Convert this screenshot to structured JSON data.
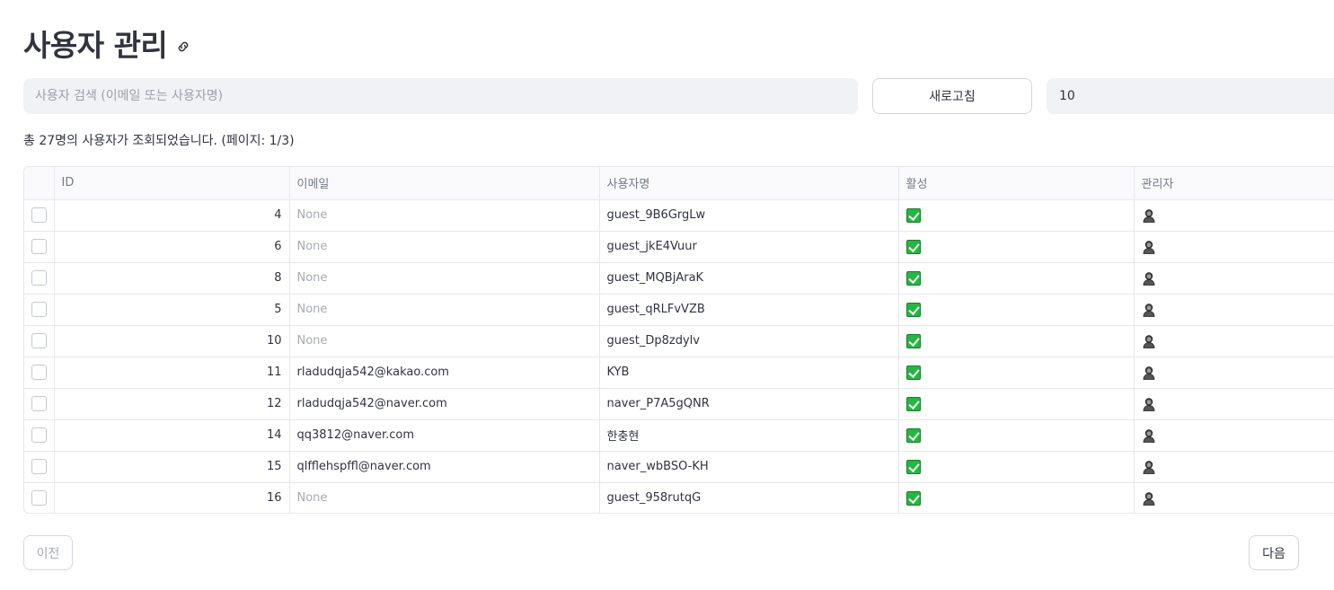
{
  "header": {
    "title": "사용자 관리",
    "link_icon": "link-icon"
  },
  "search": {
    "placeholder": "사용자 검색 (이메일 또는 사용자명)",
    "value": ""
  },
  "toolbar": {
    "refresh_label": "새로고침",
    "page_size": "10"
  },
  "summary": "총 27명의 사용자가 조회되었습니다. (페이지: 1/3)",
  "table": {
    "columns": [
      "ID",
      "이메일",
      "사용자명",
      "활성",
      "관리자"
    ],
    "rows": [
      {
        "id": "4",
        "email": "None",
        "username": "guest_9B6GrgLw",
        "active": true,
        "admin_icon": "person-icon"
      },
      {
        "id": "6",
        "email": "None",
        "username": "guest_jkE4Vuur",
        "active": true,
        "admin_icon": "person-icon"
      },
      {
        "id": "8",
        "email": "None",
        "username": "guest_MQBjAraK",
        "active": true,
        "admin_icon": "person-icon"
      },
      {
        "id": "5",
        "email": "None",
        "username": "guest_qRLFvVZB",
        "active": true,
        "admin_icon": "person-icon"
      },
      {
        "id": "10",
        "email": "None",
        "username": "guest_Dp8zdylv",
        "active": true,
        "admin_icon": "person-icon"
      },
      {
        "id": "11",
        "email": "rladudqja542@kakao.com",
        "username": "KYB",
        "active": true,
        "admin_icon": "person-icon"
      },
      {
        "id": "12",
        "email": "rladudqja542@naver.com",
        "username": "naver_P7A5gQNR",
        "active": true,
        "admin_icon": "person-icon"
      },
      {
        "id": "14",
        "email": "qq3812@naver.com",
        "username": "한충현",
        "active": true,
        "admin_icon": "person-icon"
      },
      {
        "id": "15",
        "email": "qlfflehspffl@naver.com",
        "username": "naver_wbBSO-KH",
        "active": true,
        "admin_icon": "person-icon"
      },
      {
        "id": "16",
        "email": "None",
        "username": "guest_958rutqG",
        "active": true,
        "admin_icon": "person-icon"
      }
    ]
  },
  "pagination": {
    "prev_label": "이전",
    "next_label": "다음"
  },
  "colors": {
    "active_check": "#23b83f",
    "input_background": "#f0f2f6"
  }
}
